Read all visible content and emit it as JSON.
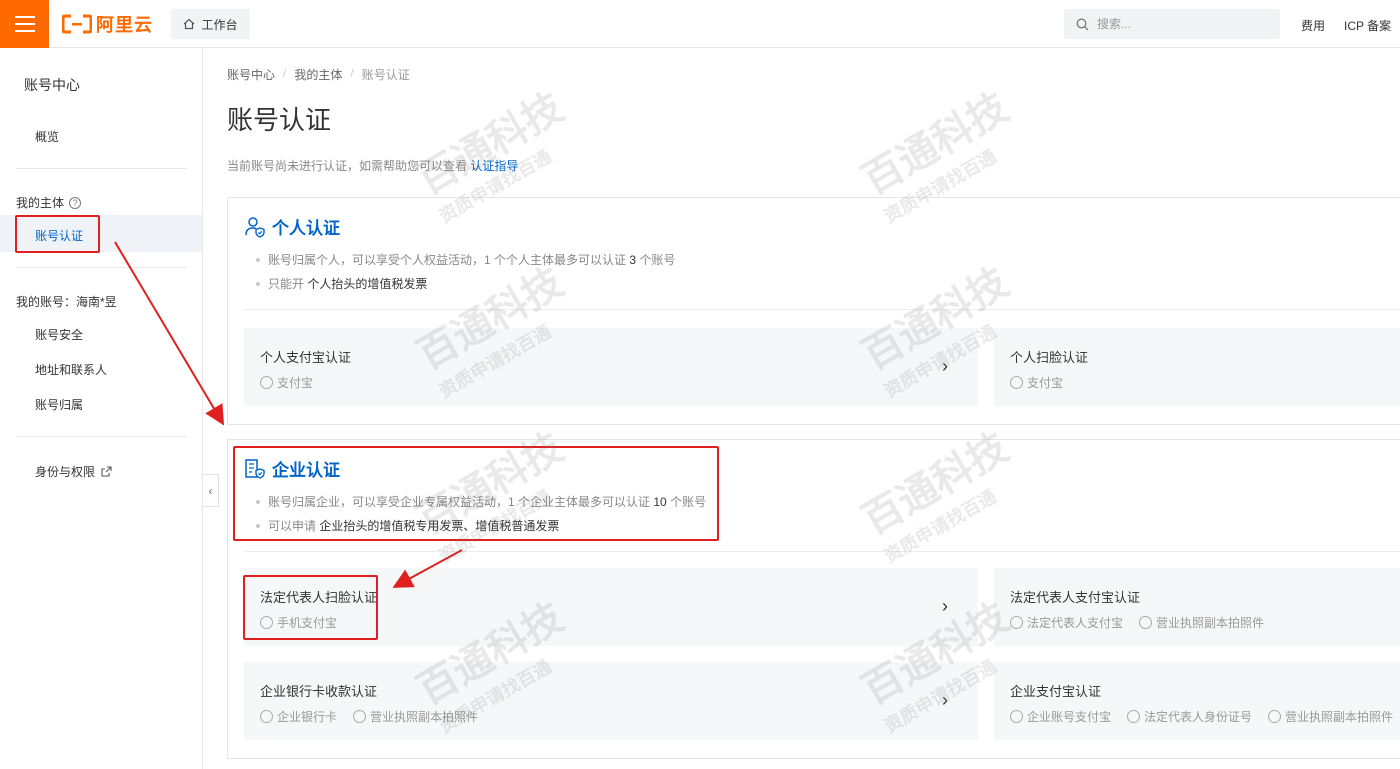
{
  "header": {
    "logo_text": "阿里云",
    "workbench_label": "工作台",
    "search_placeholder": "搜索...",
    "links": [
      "费用",
      "ICP 备案"
    ]
  },
  "sidebar": {
    "title": "账号中心",
    "overview": "概览",
    "group_entity": "我的主体",
    "active_item": "账号认证",
    "group_account": "我的账号：海南*昱",
    "account_items": [
      "账号安全",
      "地址和联系人",
      "账号归属"
    ],
    "identity": "身份与权限"
  },
  "breadcrumb": [
    "账号中心",
    "我的主体",
    "账号认证"
  ],
  "page": {
    "title": "账号认证",
    "desc": "当前账号尚未进行认证，如需帮助您可以查看",
    "desc_link": "认证指导"
  },
  "personal": {
    "title": "个人认证",
    "bullet1_pre": "账号归属个人，可以享受个人权益活动，1 个个人主体最多可以认证",
    "bullet1_num": "3",
    "bullet1_post": "个账号",
    "bullet2_pre": "只能开",
    "bullet2_bold": "个人抬头的增值税发票",
    "options": [
      {
        "title": "个人支付宝认证",
        "subs": [
          "支付宝"
        ]
      },
      {
        "title": "个人扫脸认证",
        "subs": [
          "支付宝"
        ]
      }
    ]
  },
  "enterprise": {
    "title": "企业认证",
    "bullet1_pre": "账号归属企业，可以享受企业专属权益活动，1 个企业主体最多可以认证",
    "bullet1_num": "10",
    "bullet1_post": "个账号",
    "bullet2_pre": "可以申请",
    "bullet2_bold": "企业抬头的增值税专用发票、增值税普通发票",
    "options": [
      {
        "title": "法定代表人扫脸认证",
        "subs": [
          "手机支付宝"
        ]
      },
      {
        "title": "法定代表人支付宝认证",
        "subs": [
          "法定代表人支付宝",
          "营业执照副本拍照件"
        ]
      },
      {
        "title": "企业银行卡收款认证",
        "subs": [
          "企业银行卡",
          "营业执照副本拍照件"
        ]
      },
      {
        "title": "企业支付宝认证",
        "subs": [
          "企业账号支付宝",
          "法定代表人身份证号",
          "营业执照副本拍照件"
        ]
      }
    ]
  },
  "watermark": {
    "main": "百通科技",
    "sub": "资质申请找百通"
  },
  "colors": {
    "brand": "#ff6a00",
    "link": "#0064c8",
    "annotation": "#e02020"
  }
}
